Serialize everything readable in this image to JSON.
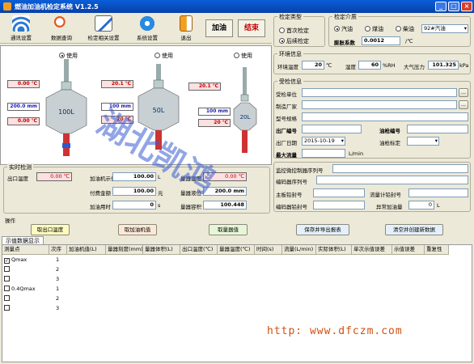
{
  "window": {
    "title": "燃油加油机检定系统 V1.2.5"
  },
  "toolbar": {
    "buttons": [
      "通讯设置",
      "数据查询",
      "检定相关设置",
      "系统设置",
      "退出"
    ],
    "add_oil": "加油",
    "end": "结束"
  },
  "tanks": {
    "use_label": "使用",
    "left": {
      "temp_red": "0.00 ℃",
      "level": "200.0 mm",
      "temp2": "0.00 ℃",
      "capacity": "100L"
    },
    "mid": {
      "temp_red": "20.1 ℃",
      "level": "100 mm",
      "temp2": "20 ℃",
      "capacity": "50L"
    },
    "right": {
      "temp_red": "20.1 ℃",
      "level": "100 mm",
      "temp2": "20 ℃",
      "capacity": "20L"
    }
  },
  "instant": {
    "title": "实时检测",
    "outlet_temp_label": "出口温度",
    "outlet_temp": "0.00 ℃",
    "machine_label": "加油机示值",
    "machine_value": "100.00",
    "machine_unit": "L",
    "pay_label": "付费金额",
    "pay_value": "100.00",
    "pay_unit": "元",
    "time_label": "加油用时",
    "time_value": "0",
    "time_unit": "s",
    "vessel_temp_label": "量器温度",
    "vessel_temp": "0.00 ℃",
    "vessel_level_label": "量器液位",
    "vessel_level": "200.0 mm",
    "vessel_vol_label": "量器容积",
    "vessel_vol": "100.448"
  },
  "ops": {
    "title": "操作",
    "b1": "取出口温度",
    "b2": "取加油机值",
    "b3": "取量器值",
    "b4": "保存并导出报表",
    "b5": "清空并创建新数据"
  },
  "type": {
    "title": "检定类型",
    "first": "首次检定",
    "followup": "后续检定"
  },
  "medium": {
    "title": "检定介质",
    "gasoline": "汽油",
    "kerosene": "煤油",
    "diesel": "柴油",
    "grade": "92#汽油",
    "expand_label": "膨胀系数",
    "expand_value": "0.0012",
    "expand_unit": "/℃"
  },
  "env": {
    "title": "环境信息",
    "temp_label": "环境温度",
    "temp": "20",
    "temp_unit": "℃",
    "hum_label": "湿度",
    "hum": "60",
    "hum_unit": "%RH",
    "press_label": "大气压力",
    "press": "101.325",
    "press_unit": "kPa"
  },
  "dut": {
    "title": "受检信息",
    "unit_label": "受检单位",
    "mfr_label": "制造厂家",
    "model_label": "型号规格",
    "serial_label": "出厂编号",
    "gun_label": "油枪编号",
    "date_label": "出厂日期",
    "date": "2015-10-19",
    "gun_mark_label": "油枪标定",
    "max_label": "最大流量",
    "max_unit": "L/min"
  },
  "ctrl": {
    "controller_label": "监控微控制器序列号",
    "encoder_label": "编码器序列号",
    "main_seal_label": "主板铅封号",
    "flow_seal_label": "流量计铅封号",
    "encoder_seal_label": "编码器铅封号",
    "abnormal_label": "异常加油量",
    "abnormal_value": "0",
    "abnormal_unit": "L"
  },
  "data_tab": {
    "label": "示值数据显示"
  },
  "table": {
    "headers": [
      "测量点",
      "次序",
      "加油机值(L)",
      "量器刻度(mm)",
      "量器体积(L)",
      "出口温度(℃)",
      "量器温度(℃)",
      "时间(s)",
      "流量(L/min)",
      "实际体积(L)",
      "单次示值误差",
      "示值误差",
      "重复性"
    ],
    "rows": [
      {
        "point": "Qmax",
        "order": "1",
        "checked": true
      },
      {
        "point": "",
        "order": "2",
        "checked": false
      },
      {
        "point": "",
        "order": "3",
        "checked": false
      },
      {
        "point": "0.4Qmax",
        "order": "1",
        "checked": false
      },
      {
        "point": "",
        "order": "2",
        "checked": false
      },
      {
        "point": "",
        "order": "3",
        "checked": false
      }
    ]
  },
  "watermark": {
    "url": "http: www.dfczm.com"
  }
}
